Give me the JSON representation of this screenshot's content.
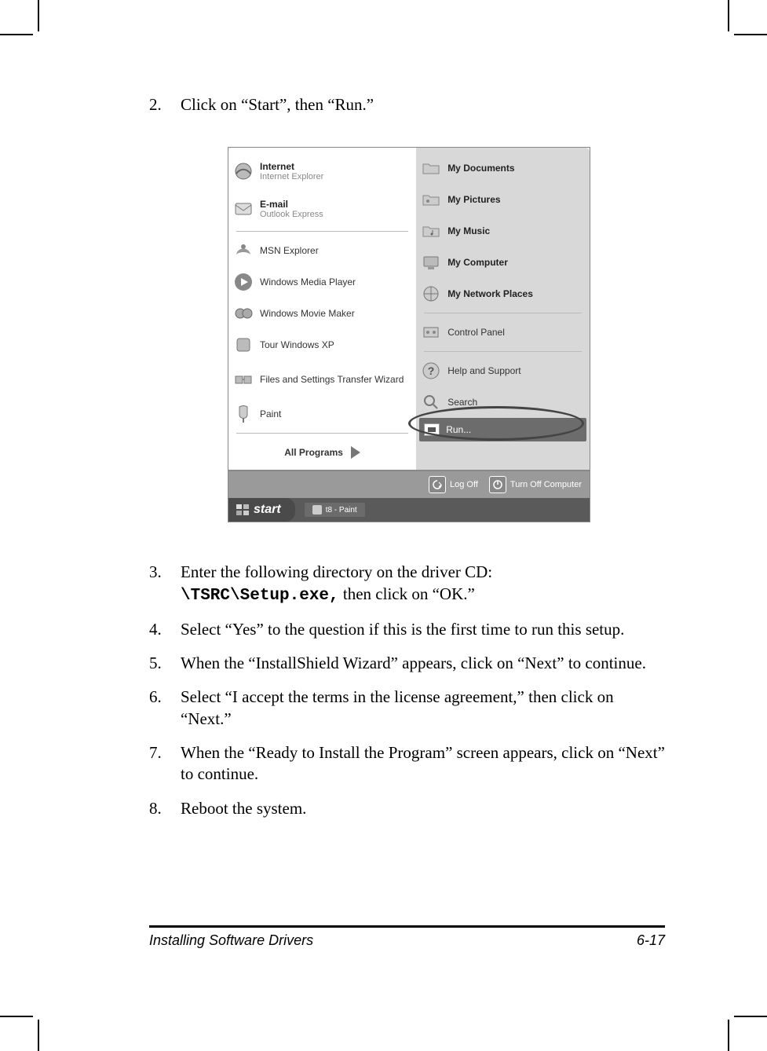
{
  "steps": {
    "s2": {
      "num": "2.",
      "text": "Click on “Start”, then “Run.”"
    },
    "s3": {
      "num": "3.",
      "before": "Enter the following directory on the driver CD: ",
      "code": "\\TSRC\\Setup.exe,",
      "after": " then click on “OK.”"
    },
    "s4": {
      "num": "4.",
      "text": "Select “Yes” to the question if this is the first time to run this setup."
    },
    "s5": {
      "num": "5.",
      "text": "When the “InstallShield Wizard” appears, click on “Next” to continue."
    },
    "s6": {
      "num": "6.",
      "text": "Select “I accept the terms in the license agreement,” then click on “Next.”"
    },
    "s7": {
      "num": "7.",
      "text": "When the “Ready to Install the Program” screen appears, click on “Next” to continue."
    },
    "s8": {
      "num": "8.",
      "text": "Reboot the system."
    }
  },
  "menu": {
    "left": {
      "internet_title": "Internet",
      "internet_sub": "Internet Explorer",
      "email_title": "E-mail",
      "email_sub": "Outlook Express",
      "msn": "MSN Explorer",
      "wmp": "Windows Media Player",
      "wmm": "Windows Movie Maker",
      "tour": "Tour Windows XP",
      "fst": "Files and Settings Transfer Wizard",
      "paint": "Paint",
      "allprograms": "All Programs"
    },
    "right": {
      "mydocs": "My Documents",
      "mypics": "My Pictures",
      "mymusic": "My Music",
      "mycomp": "My Computer",
      "mynet": "My Network Places",
      "cpanel": "Control Panel",
      "help": "Help and Support",
      "search": "Search",
      "run": "Run..."
    },
    "bottom": {
      "logoff": "Log Off",
      "turnoff": "Turn Off Computer"
    },
    "taskbar": {
      "start": "start",
      "task1": "t8 - Paint"
    }
  },
  "footer": {
    "title": "Installing Software Drivers",
    "page": "6-17"
  }
}
